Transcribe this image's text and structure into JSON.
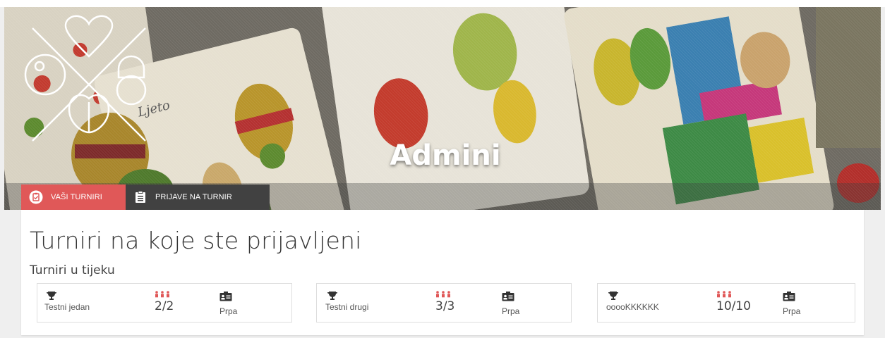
{
  "header": {
    "title": "Admini"
  },
  "tabs": [
    {
      "label": "VAŠI TURNIRI",
      "icon": "clipboard-check-icon",
      "active": true
    },
    {
      "label": "PRIJAVE NA TURNIR",
      "icon": "clipboard-list-icon",
      "active": false
    }
  ],
  "main": {
    "title": "Turniri na koje ste prijavljeni",
    "subtitle": "Turniri u tijeku",
    "tournaments": [
      {
        "name": "Testni jedan",
        "players": "2/2",
        "type": "Prpa"
      },
      {
        "name": "Testni drugi",
        "players": "3/3",
        "type": "Prpa"
      },
      {
        "name": "ooooKKKKKK",
        "players": "10/10",
        "type": "Prpa"
      }
    ]
  },
  "colors": {
    "accent": "#e05858",
    "tab_dark": "#414141",
    "players_icon": "#e05858"
  }
}
